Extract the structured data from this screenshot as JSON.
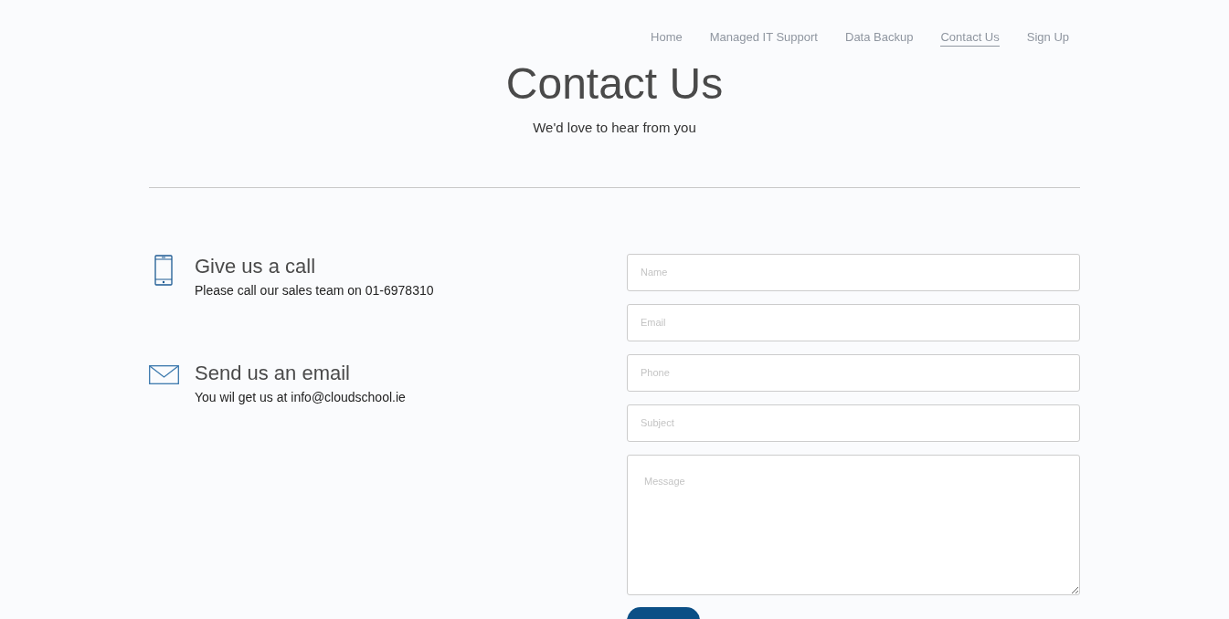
{
  "nav": [
    {
      "label": "Home",
      "selected": false
    },
    {
      "label": "Managed IT Support",
      "selected": false
    },
    {
      "label": "Data Backup",
      "selected": false
    },
    {
      "label": "Contact Us",
      "selected": true
    },
    {
      "label": "Sign Up",
      "selected": false
    }
  ],
  "header": {
    "title": "Contact Us",
    "subtitle": "We'd love to hear from you"
  },
  "contacts": [
    {
      "kind": "phone",
      "title": "Give us a call",
      "text": "Please call our sales team on 01-6978310"
    },
    {
      "kind": "email",
      "title": "Send us an email",
      "text": "You wil get us at info@cloudschool.ie"
    }
  ],
  "form": {
    "fields": [
      {
        "kind": "input",
        "placeholder": "Name"
      },
      {
        "kind": "input",
        "placeholder": "Email"
      },
      {
        "kind": "input",
        "placeholder": "Phone"
      },
      {
        "kind": "input",
        "placeholder": "Subject"
      },
      {
        "kind": "textarea",
        "placeholder": "Message"
      }
    ]
  }
}
